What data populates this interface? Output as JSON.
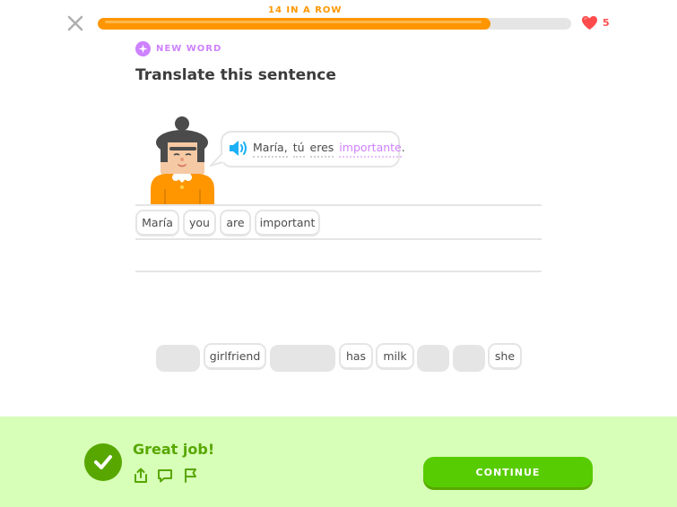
{
  "header": {
    "streak_text": "14 IN A ROW",
    "progress": 0.83,
    "hearts": "5"
  },
  "lesson": {
    "badge": "NEW WORD",
    "title": "Translate this sentence",
    "sentence": {
      "w1": "María,",
      "w2": "tú",
      "w3": "eres",
      "w4": "importante",
      "end": "."
    }
  },
  "answer_tokens": [
    "María",
    "you",
    "are",
    "important"
  ],
  "word_bank": [
    "girlfriend",
    "has",
    "milk",
    "she"
  ],
  "feedback": {
    "message": "Great job!",
    "continue_label": "CONTINUE"
  },
  "colors": {
    "progress": "#ff9600",
    "success": "#58a700",
    "button": "#58cc02",
    "highlight": "#ce82ff",
    "heart": "#ff4b4b"
  }
}
